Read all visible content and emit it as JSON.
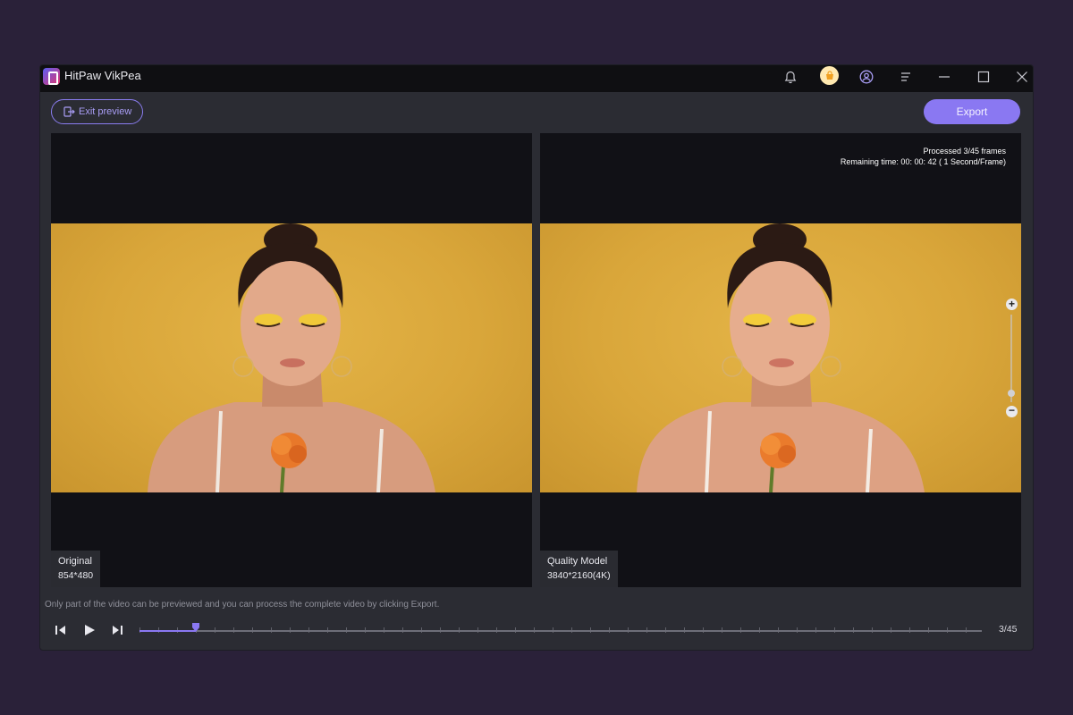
{
  "app": {
    "title": "HitPaw VikPea",
    "titlebar_icons": [
      "notification-icon",
      "shop-icon",
      "account-icon",
      "menu-icon",
      "minimize-icon",
      "maximize-icon",
      "close-icon"
    ]
  },
  "toolbar": {
    "exit_label": "Exit preview",
    "export_label": "Export"
  },
  "left_panel": {
    "model": "Original",
    "resolution": "854*480"
  },
  "right_panel": {
    "model": "Quality Model",
    "resolution": "3840*2160(4K)",
    "processed": "Processed 3/45 frames",
    "remaining": "Remaining time: 00: 00: 42 ( 1 Second/Frame)",
    "zoom_in": "+",
    "zoom_out": "−"
  },
  "footer": {
    "hint": "Only part of the video can be previewed and you can process the complete video by clicking Export.",
    "frame_counter": "3/45",
    "current_frame": 3,
    "total_frames": 45
  },
  "colors": {
    "accent": "#8a78f2",
    "background": "#2a2139",
    "window": "#2b2c33",
    "panel": "#111116",
    "photo_wall": "#d9a73a"
  }
}
